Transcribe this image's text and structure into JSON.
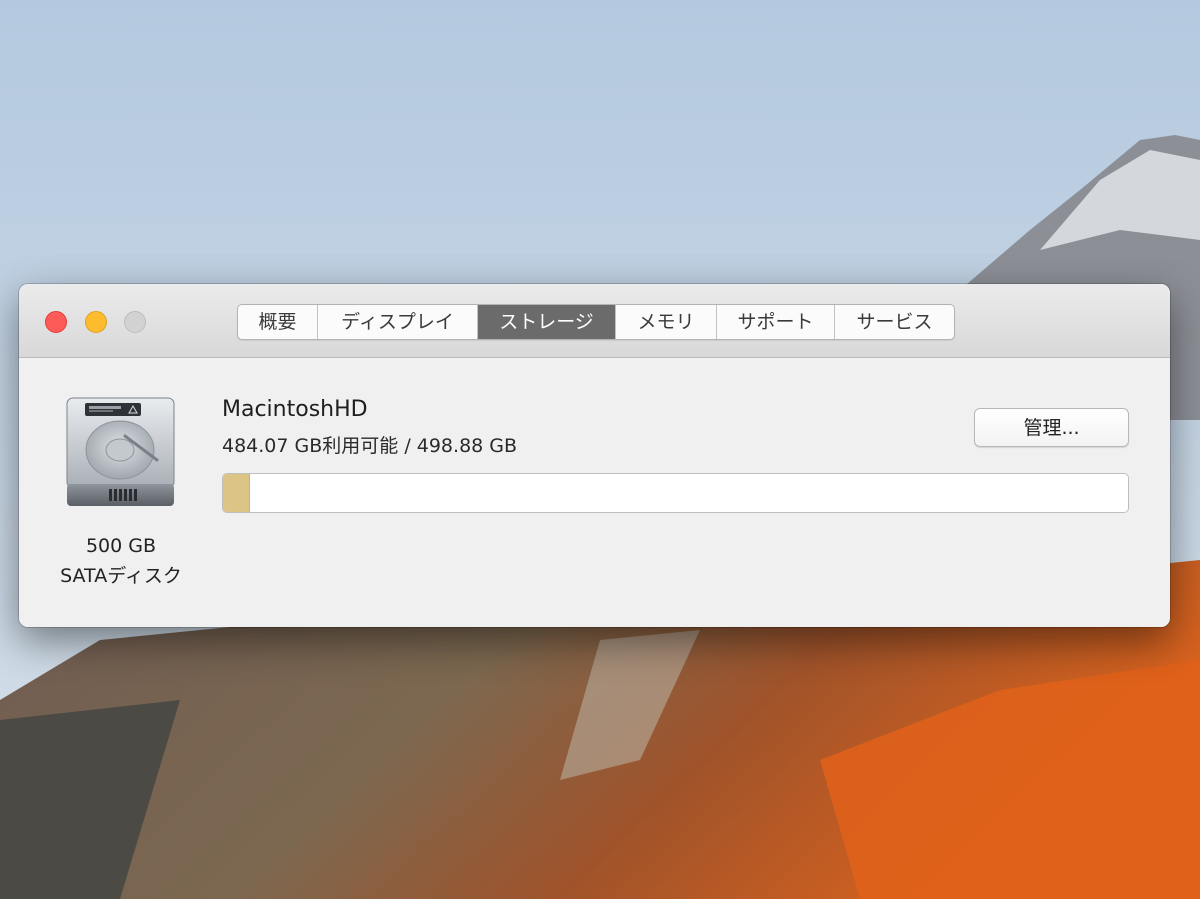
{
  "window": {
    "tabs": [
      {
        "label": "概要",
        "active": false
      },
      {
        "label": "ディスプレイ",
        "active": false
      },
      {
        "label": "ストレージ",
        "active": true
      },
      {
        "label": "メモリ",
        "active": false
      },
      {
        "label": "サポート",
        "active": false
      },
      {
        "label": "サービス",
        "active": false
      }
    ]
  },
  "disk": {
    "icon": "hard-drive-icon",
    "size": "500 GB",
    "type": "SATAディスク"
  },
  "volume": {
    "name": "MacintoshHD",
    "available_text": "484.07 GB利用可能 / 498.88 GB",
    "used_fraction": 0.03,
    "used_color": "#dcc487"
  },
  "actions": {
    "manage_label": "管理..."
  },
  "colors": {
    "close": "#fc5b57",
    "minimize": "#fdbb2e",
    "zoom_disabled": "#d3d2d2",
    "active_tab": "#6b6b6b"
  }
}
